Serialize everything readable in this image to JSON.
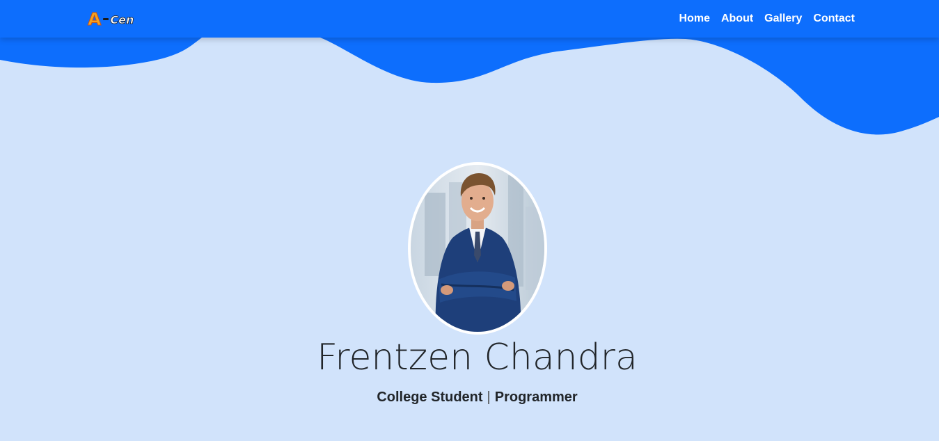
{
  "brand": {
    "letter": "A",
    "text": "Cen"
  },
  "nav": {
    "items": [
      {
        "label": "Home"
      },
      {
        "label": "About"
      },
      {
        "label": "Gallery"
      },
      {
        "label": "Contact"
      }
    ]
  },
  "hero": {
    "name": "Frentzen Chandra",
    "roles": [
      "College Student",
      "Programmer"
    ],
    "separator": "|"
  },
  "colors": {
    "primary": "#0d6efd",
    "background": "#d1e3fb",
    "text": "#212529",
    "logo_orange": "#f6a21e"
  }
}
